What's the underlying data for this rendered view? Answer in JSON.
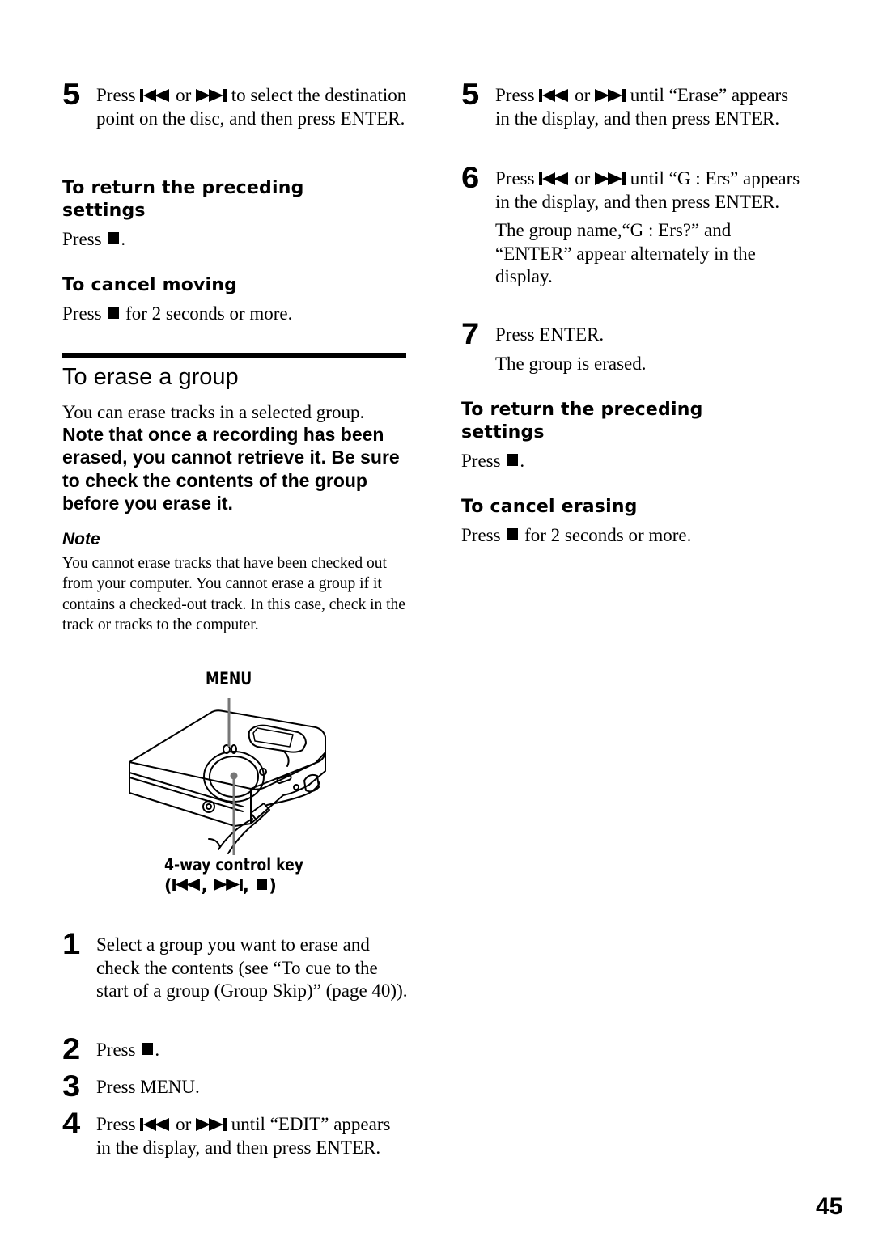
{
  "left_column": {
    "step5_prev": {
      "number": "5",
      "text_before": "Press",
      "text_or": "or",
      "text_after": "to select the destination point on the disc, and then press ENTER."
    },
    "return_settings_1": {
      "heading": "To return the preceding settings",
      "text_before": "Press",
      "text_after": "."
    },
    "cancel_moving": {
      "heading": "To cancel moving",
      "text_before": "Press",
      "text_after": "for 2 seconds or more."
    },
    "section": {
      "title": "To erase a group",
      "intro": "You can erase tracks in a selected group.",
      "warning": "Note that once a recording has been erased, you cannot retrieve it. Be sure to check the contents of the group before you erase it."
    },
    "note": {
      "title": "Note",
      "text": "You cannot erase tracks that have been checked out from your computer. You cannot erase a group if it contains a checked-out track. In this case, check in the track or tracks to the computer."
    },
    "figure": {
      "menu_label": "MENU",
      "control_label": "4-way control key",
      "control_open": "(",
      "control_sep1": ",",
      "control_sep2": ",",
      "control_close": ")"
    },
    "steps": [
      {
        "number": "1",
        "text": "Select a group you want to erase and check the contents (see “To cue to the start of a group (Group Skip)” (page 40))."
      },
      {
        "number": "2",
        "text_before": "Press",
        "text_after": "."
      },
      {
        "number": "3",
        "text": "Press MENU."
      },
      {
        "number": "4",
        "text_before": "Press",
        "text_or": "or",
        "text_after": "until “EDIT” appears in the display, and then press ENTER."
      }
    ]
  },
  "right_column": {
    "steps": [
      {
        "number": "5",
        "text_before": "Press",
        "text_or": "or",
        "text_after": "until “Erase” appears in the display, and then press ENTER."
      },
      {
        "number": "6",
        "text_before": "Press",
        "text_or": "or",
        "text_after": "until “G : Ers” appears in the display, and then press ENTER.",
        "sub": "The group name,“G : Ers?” and “ENTER” appear alternately in the display."
      },
      {
        "number": "7",
        "text": "Press ENTER.",
        "sub": "The group is erased."
      }
    ],
    "return_settings_2": {
      "heading": "To return the preceding settings",
      "text_before": "Press",
      "text_after": "."
    },
    "cancel_erasing": {
      "heading": "To cancel erasing",
      "text_before": "Press",
      "text_after": "for 2 seconds or more."
    }
  },
  "icons": {
    "prev": "previous-track-icon",
    "next": "next-track-icon",
    "stop": "stop-icon"
  },
  "page_number": "45"
}
